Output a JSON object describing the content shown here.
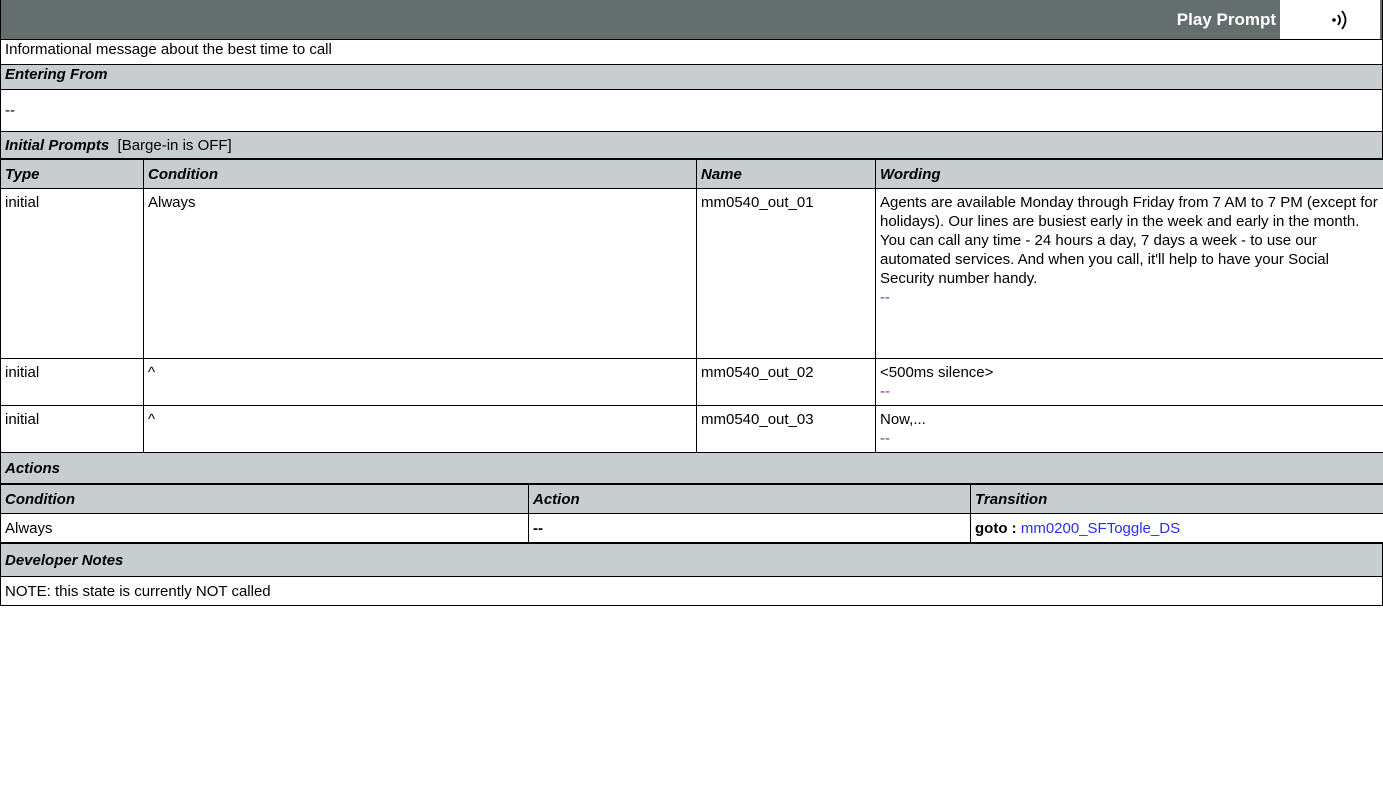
{
  "header": {
    "title": "Play Prompt",
    "icon": "speaker-sound-icon"
  },
  "description": "Informational message about the best time to call",
  "entering_from": {
    "label": "Entering From",
    "value": "--"
  },
  "initial_prompts": {
    "label": "Initial Prompts",
    "barge_in": "[Barge-in is OFF]",
    "columns": {
      "type": "Type",
      "condition": "Condition",
      "name": "Name",
      "wording": "Wording"
    },
    "rows": [
      {
        "type": "initial",
        "condition": "Always",
        "name": "mm0540_out_01",
        "wording": "Agents are available Monday through Friday from 7 AM to 7 PM (except for holidays). Our lines are busiest early in the week and early in the month. You can call any time - 24 hours a day, 7 days a week - to use our automated services.  And when you call, it'll help to have your Social Security number handy.",
        "extra": "--"
      },
      {
        "type": "initial",
        "condition": "^",
        "name": "mm0540_out_02",
        "wording": "<500ms silence>",
        "extra": "--"
      },
      {
        "type": "initial",
        "condition": "^",
        "name": "mm0540_out_03",
        "wording": "Now,...",
        "extra": "--"
      }
    ]
  },
  "actions": {
    "label": "Actions",
    "columns": {
      "condition": "Condition",
      "action": "Action",
      "transition": "Transition"
    },
    "rows": [
      {
        "condition": "Always",
        "action": "--",
        "transition_prefix": "goto :",
        "transition_target": "mm0200_SFToggle_DS"
      }
    ]
  },
  "developer_notes": {
    "label": "Developer Notes",
    "text": "NOTE: this state is currently NOT called"
  },
  "colors": {
    "header_bg": "#646f6d",
    "section_bg": "#c8ced0",
    "link": "#2c2cff",
    "dash": "#8b2a8b"
  }
}
